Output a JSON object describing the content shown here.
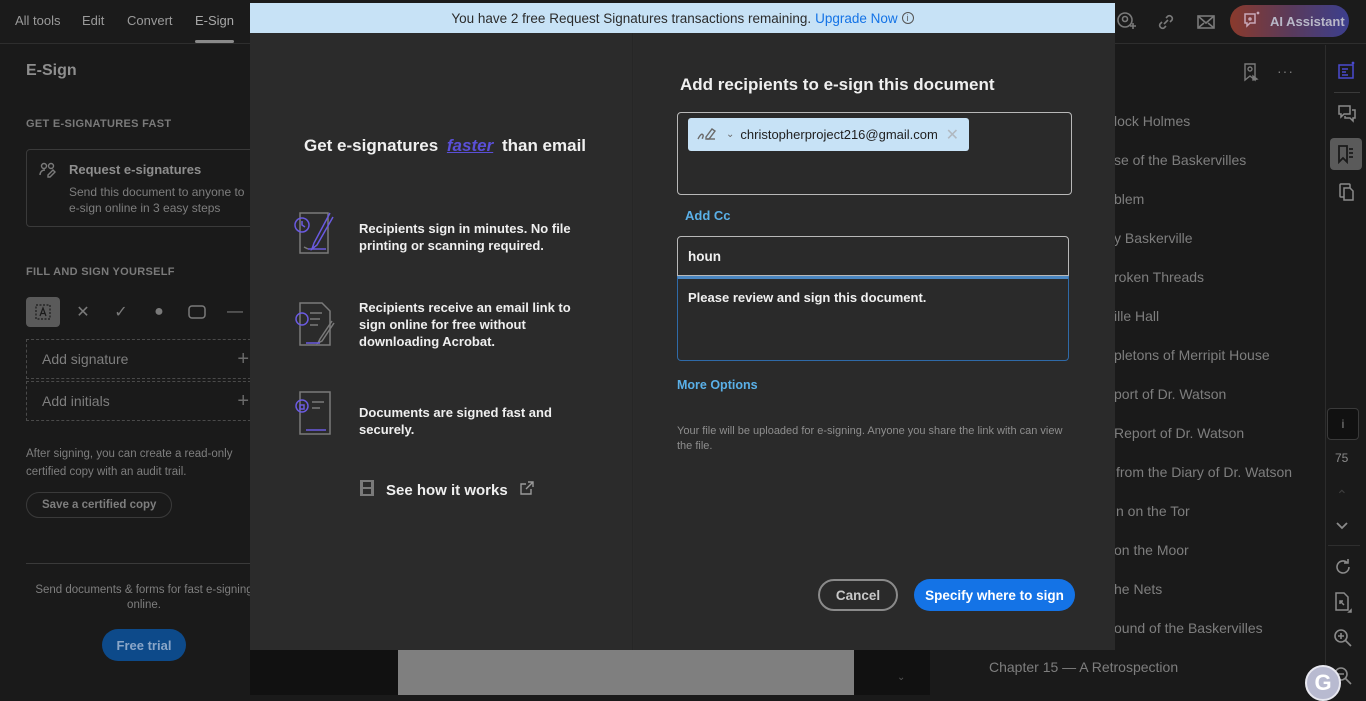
{
  "topnav": {
    "tabs": [
      {
        "label": "All tools"
      },
      {
        "label": "Edit"
      },
      {
        "label": "Convert"
      },
      {
        "label": "E-Sign",
        "active": true
      }
    ],
    "icons": [
      "add-user-icon",
      "link-icon",
      "mail-icon"
    ],
    "ai_assistant_label": "AI Assistant"
  },
  "left_panel": {
    "title": "E-Sign",
    "section1": "GET E-SIGNATURES FAST",
    "request_card": {
      "title": "Request e-signatures",
      "description": "Send this document to anyone to e-sign online in 3 easy steps"
    },
    "section2": "FILL AND SIGN YOURSELF",
    "tools": [
      "text-tool",
      "cross-tool",
      "check-tool",
      "dot-tool",
      "rectangle-tool",
      "line-tool"
    ],
    "add_signature": "Add signature",
    "add_initials": "Add initials",
    "note": "After signing, you can create a read-only certified copy with an audit trail.",
    "certified_button": "Save a certified copy",
    "promo": "Send documents & forms for fast e-signing online.",
    "free_trial_button": "Free trial"
  },
  "modal": {
    "banner": {
      "text": "You have 2 free Request Signatures transactions remaining.",
      "link": "Upgrade Now"
    },
    "left": {
      "hero_prefix": "Get e-signatures",
      "hero_emphasis": "faster",
      "hero_suffix": "than email",
      "features": [
        {
          "icon": "sign-timer-icon",
          "text": "Recipients sign in minutes. No file printing or scanning required."
        },
        {
          "icon": "sign-notify-icon",
          "text": "Recipients receive an email link to sign online for free without downloading Acrobat."
        },
        {
          "icon": "sign-secure-icon",
          "text": "Documents are signed fast and securely."
        }
      ],
      "see_how": "See how it works"
    },
    "right": {
      "title": "Add recipients to e-sign this document",
      "recipients": [
        {
          "email": "christopherproject216@gmail.com",
          "role_icon": "signer-icon"
        }
      ],
      "add_cc": "Add Cc",
      "subject_value": "houn",
      "message_value": "Please review and sign this document.",
      "more_options": "More Options",
      "upload_note": "Your file will be uploaded for e-signing. Anyone you share the link with can view the file.",
      "cancel_button": "Cancel",
      "primary_button": "Specify where to sign"
    }
  },
  "bookmarks": [
    "lock Holmes",
    "se of the Baskervilles",
    "blem",
    "y Baskerville",
    "roken Threads",
    "ille Hall",
    "pletons of Merripit House",
    "port of Dr. Watson",
    "Report of Dr. Watson",
    "from the Diary of Dr. Watson",
    "n on the Tor",
    "on the Moor",
    "he Nets",
    "ound of the Baskervilles",
    "Chapter 15 — A Retrospection"
  ],
  "rail": {
    "page_indicator": "i",
    "zoom_value": "75"
  },
  "colors": {
    "accent_blue": "#1473e6",
    "banner_bg": "#c7e2f6",
    "link_blue": "#5ab0e8",
    "faster_purple": "#5a4fd8"
  }
}
